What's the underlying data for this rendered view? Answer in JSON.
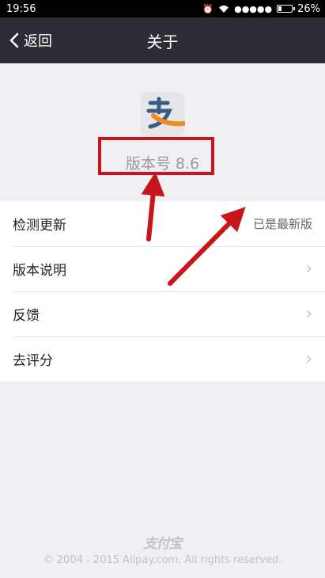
{
  "status_bar": {
    "time": "19:56",
    "signal": "●●●●●",
    "battery_percent": "26%",
    "battery_level": 0.26
  },
  "nav": {
    "back_label": "返回",
    "title": "关于"
  },
  "about": {
    "version": "版本号 8.6"
  },
  "menu": {
    "items": [
      {
        "label": "检测更新",
        "value": "已是最新版"
      },
      {
        "label": "版本说明",
        "chevron": "›"
      },
      {
        "label": "反馈",
        "chevron": "›"
      },
      {
        "label": "去评分",
        "chevron": "›"
      }
    ]
  },
  "footer": {
    "logo_text": "支付宝",
    "copyright": "© 2004 - 2015 Alipay.com. All rights reserved."
  },
  "colors": {
    "nav_bg": "#2b2c34",
    "annotation_red": "#c8151b",
    "logo_blue": "#3b5a8a",
    "logo_orange": "#ef8a1e"
  }
}
